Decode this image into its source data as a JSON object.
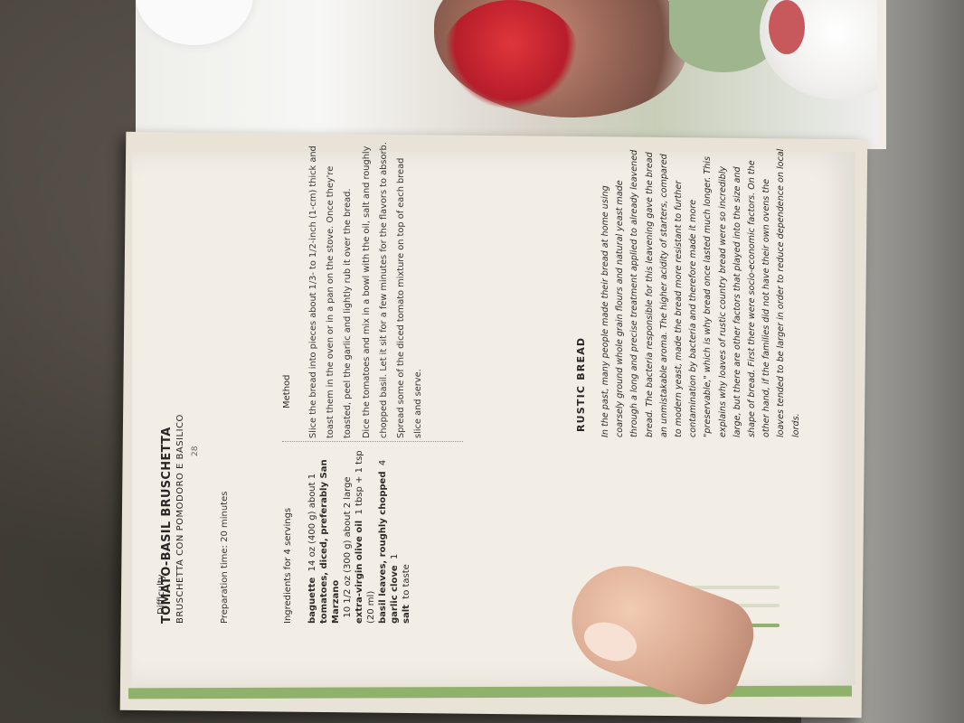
{
  "recipe": {
    "title": "TOMATO-BASIL BRUSCHETTA",
    "subtitle": "BRUSCHETTA CON POMODORO E BASILICO",
    "prep_time": "Preparation time: 20 minutes",
    "ingredients_header": "Ingredients for 4 servings",
    "ingredients": [
      {
        "name": "baguette",
        "amount": "14 oz (400 g) about 1"
      },
      {
        "name": "tomatoes, diced, preferably San Marzano",
        "amount": "10 1/2 oz (300 g) about 2 large"
      },
      {
        "name": "extra-virgin olive oil",
        "amount": "1 tbsp + 1 tsp (20 ml)"
      },
      {
        "name": "basil leaves, roughly chopped",
        "amount": "4"
      },
      {
        "name": "garlic clove",
        "amount": "1"
      },
      {
        "name": "salt",
        "amount": "to taste"
      }
    ],
    "difficulty_label": "Difficulty",
    "method_header": "Method",
    "method": [
      "Slice the bread into pieces about 1/3- to 1/2-inch (1-cm) thick and toast them in the oven or in a pan on the stove. Once they're toasted, peel the garlic and lightly rub it over the bread.",
      "Dice the tomatoes and mix in a bowl with the oil, salt and roughly chopped basil. Let it sit for a few minutes for the flavors to absorb. Spread some of the diced tomato mixture on top of each bread slice and serve."
    ]
  },
  "rustic": {
    "header": "RUSTIC BREAD",
    "text": "In the past, many people made their bread at home using coarsely ground whole grain flours and natural yeast made through a long and precise treatment applied to already leavened bread. The bacteria responsible for this leavening gave the bread an unmistakable aroma. The higher acidity of starters, compared to modern yeast, made the bread more resistant to further contamination by bacteria and therefore made it more \"preservable,\" which is why bread once lasted much longer. This explains why loaves of rustic country bread were so incredibly large, but there are other factors that played into the size and shape of bread. First there were socio-economic factors. On the other hand, if the families did not have their own ovens the loaves tended to be larger in order to reduce dependence on local lords."
  },
  "page_number": "28",
  "colors": {
    "page": "#f2eee6",
    "accent_green": "#8fb16b",
    "text": "#2e2b28"
  }
}
